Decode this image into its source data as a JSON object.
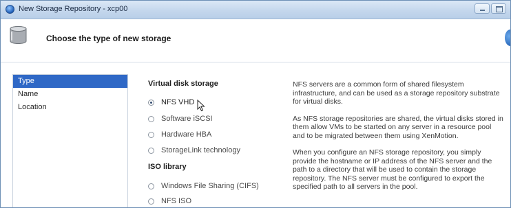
{
  "window": {
    "title": "New Storage Repository - xcp00"
  },
  "header": {
    "title": "Choose the type of new storage"
  },
  "sidebar": {
    "items": [
      {
        "label": "Type",
        "active": true
      },
      {
        "label": "Name",
        "active": false
      },
      {
        "label": "Location",
        "active": false
      }
    ]
  },
  "options": {
    "virtual_disk_heading": "Virtual disk storage",
    "virtual_disk": [
      {
        "label": "NFS VHD",
        "checked": true
      },
      {
        "label": "Software iSCSI",
        "checked": false
      },
      {
        "label": "Hardware HBA",
        "checked": false
      },
      {
        "label": "StorageLink technology",
        "checked": false
      }
    ],
    "iso_heading": "ISO library",
    "iso": [
      {
        "label": "Windows File Sharing (CIFS)",
        "checked": false
      },
      {
        "label": "NFS ISO",
        "checked": false
      }
    ]
  },
  "description": {
    "paragraphs": [
      [
        "NFS servers are a common form of shared filesystem",
        "infrastructure, and can be used as a storage repository substrate",
        "for virtual disks."
      ],
      [
        "As NFS storage repositories are shared, the virtual disks stored in",
        "them allow VMs to be started on any server in a resource pool",
        "and to be migrated between them using XenMotion."
      ],
      [
        "When you configure an NFS storage repository, you simply",
        "provide the hostname or IP address of the NFS server and the",
        "path to a directory that will be used to contain the storage",
        "repository. The NFS server must be configured to export the",
        "specified path to all servers in the pool."
      ]
    ]
  },
  "colors": {
    "accent": "#2f68c6",
    "titlebar": "#c3d6ec"
  },
  "icons": {
    "app": "app-icon",
    "storage": "storage-icon",
    "help": "help-icon",
    "minimize": "minimize-icon",
    "maximize": "maximize-icon",
    "cursor": "mouse-cursor-icon"
  }
}
